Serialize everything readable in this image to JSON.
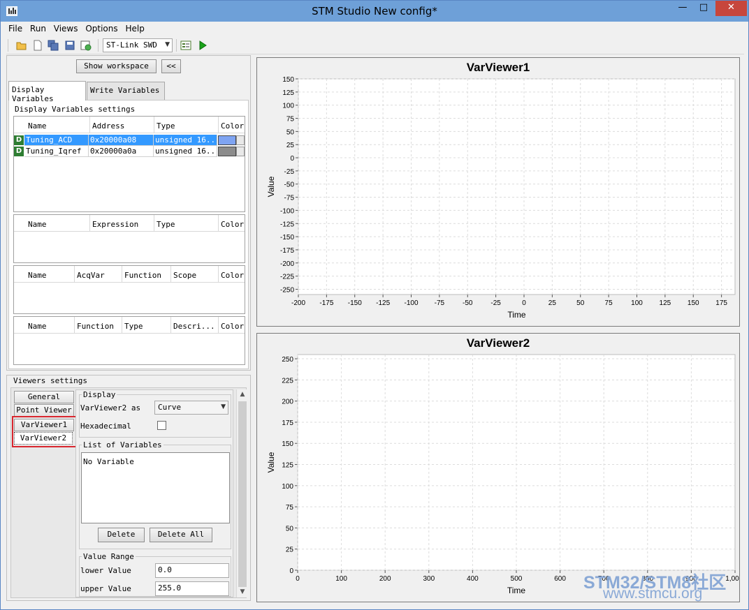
{
  "window": {
    "title": "STM Studio New config*",
    "controls": {
      "minimize": "—",
      "maximize": "□",
      "close": "✕"
    }
  },
  "menu": [
    "File",
    "Run",
    "Views",
    "Options",
    "Help"
  ],
  "toolbar": {
    "icons": [
      "open-folder-icon",
      "new-file-icon",
      "save-all-icon",
      "save-icon",
      "export-icon",
      "config-icon",
      "run-icon"
    ],
    "probe_value": "ST-Link SWD"
  },
  "workspace": {
    "show_label": "Show workspace",
    "collapse_label": "<<"
  },
  "tabs": [
    {
      "label": "Display Variables",
      "active": true
    },
    {
      "label": "Write Variables",
      "active": false
    }
  ],
  "display_settings": {
    "title": "Display Variables settings",
    "var_table": {
      "columns": [
        "Name",
        "Address",
        "Type",
        "Color"
      ],
      "rows": [
        {
          "badge": "D",
          "name": "Tuning_ACD",
          "address": "0x20000a08",
          "type": "unsigned 16...",
          "color": "#7fa4f2",
          "selected": true
        },
        {
          "badge": "D",
          "name": "Tuning_Iqref",
          "address": "0x20000a0a",
          "type": "unsigned 16...",
          "color": "#8c8c8c",
          "selected": false
        }
      ]
    },
    "expr_table": {
      "columns": [
        "Name",
        "Expression",
        "Type",
        "Color"
      ]
    },
    "acq_table": {
      "columns": [
        "Name",
        "AcqVar",
        "Function",
        "Scope",
        "Color"
      ]
    },
    "func_table": {
      "columns": [
        "Name",
        "Function",
        "Type",
        "Descri...",
        "Color"
      ]
    }
  },
  "viewers_settings": {
    "title": "Viewers settings",
    "tabs": [
      {
        "label": "General"
      },
      {
        "label": "Point Viewer"
      },
      {
        "label": "VarViewer1"
      },
      {
        "label": "VarViewer2",
        "active": true
      }
    ],
    "display": {
      "title": "Display",
      "as_label": "VarViewer2 as",
      "as_value": "Curve",
      "hex_label": "Hexadecimal",
      "hex_checked": false
    },
    "list": {
      "title": "List of Variables",
      "empty_text": "No Variable",
      "delete_label": "Delete",
      "delete_all_label": "Delete All"
    },
    "range": {
      "title": "Value Range",
      "lower_label": "lower Value",
      "lower_value": "0.0",
      "upper_label": "upper Value",
      "upper_value": "255.0"
    }
  },
  "chart_data": [
    {
      "type": "line",
      "title": "VarViewer1",
      "xlabel": "Time",
      "ylabel": "Value",
      "xlim": [
        -200,
        187
      ],
      "ylim": [
        -260,
        150
      ],
      "xticks": [
        -200,
        -175,
        -150,
        -125,
        -100,
        -75,
        -50,
        -25,
        0,
        25,
        50,
        75,
        100,
        125,
        150,
        175
      ],
      "yticks": [
        150,
        125,
        100,
        75,
        50,
        25,
        0,
        -25,
        -50,
        -75,
        -100,
        -125,
        -150,
        -175,
        -200,
        -225,
        -250
      ],
      "grid": true,
      "series": []
    },
    {
      "type": "line",
      "title": "VarViewer2",
      "xlabel": "Time",
      "ylabel": "Value",
      "xlim": [
        0,
        1000
      ],
      "ylim": [
        0,
        255
      ],
      "xticks": [
        0,
        100,
        200,
        300,
        400,
        500,
        600,
        700,
        800,
        900
      ],
      "xtick_last_label": "1,00",
      "yticks": [
        0,
        25,
        50,
        75,
        100,
        125,
        150,
        175,
        200,
        225,
        250
      ],
      "grid": true,
      "series": []
    }
  ],
  "watermark": {
    "line1": "STM32/STM8社区",
    "line2": "www.stmcu.org"
  }
}
